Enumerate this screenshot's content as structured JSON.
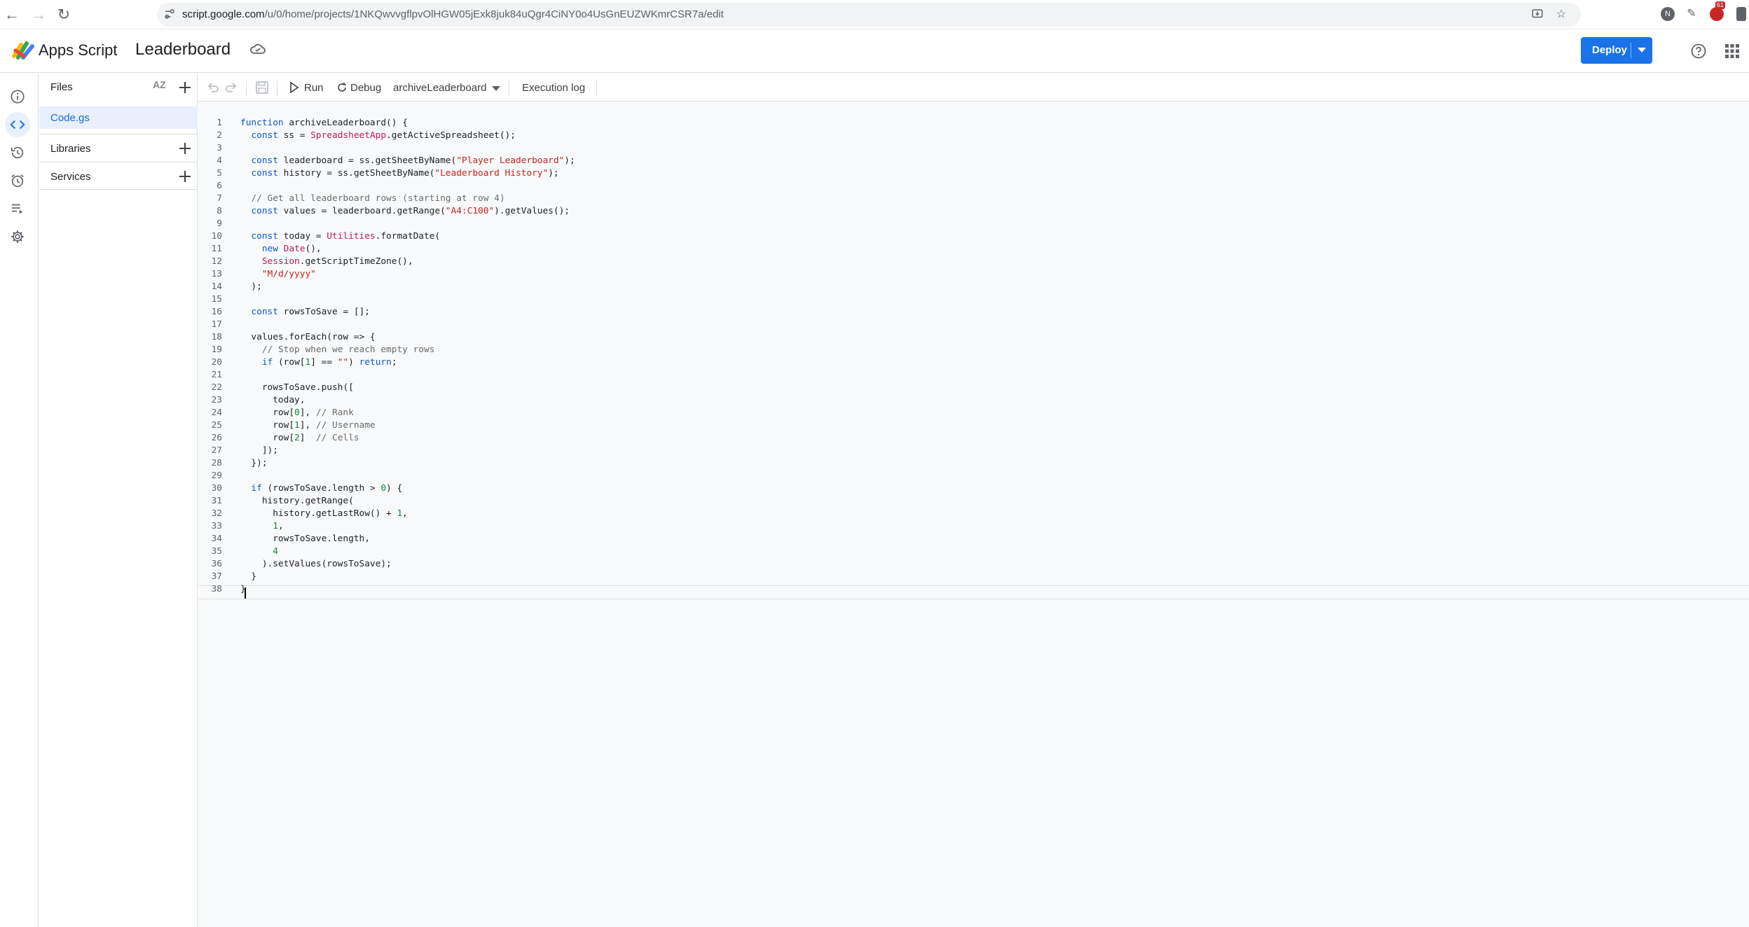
{
  "browser": {
    "url_host": "script.google.com",
    "url_path": "/u/0/home/projects/1NKQwvvgflpvOlHGW05jExk8juk84uQgr4CiNY0o4UsGnEUZWKmrCSR7a/edit",
    "extension_badge": "61",
    "profile_initial": "N"
  },
  "header": {
    "app_name": "Apps Script",
    "project_name": "Leaderboard",
    "deploy_label": "Deploy"
  },
  "files_panel": {
    "title": "Files",
    "sort_label": "AZ",
    "files": [
      "Code.gs"
    ],
    "libraries_label": "Libraries",
    "services_label": "Services"
  },
  "toolbar": {
    "run_label": "Run",
    "debug_label": "Debug",
    "function_select": "archiveLeaderboard",
    "execution_log_label": "Execution log"
  },
  "editor": {
    "line_numbers": [
      "1",
      "2",
      "3",
      "4",
      "5",
      "6",
      "7",
      "8",
      "9",
      "10",
      "11",
      "12",
      "13",
      "14",
      "15",
      "16",
      "17",
      "18",
      "19",
      "20",
      "21",
      "22",
      "23",
      "24",
      "25",
      "26",
      "27",
      "28",
      "29",
      "30",
      "31",
      "32",
      "33",
      "34",
      "35",
      "36",
      "37",
      "38"
    ],
    "lines": [
      "function archiveLeaderboard() {",
      "  const ss = SpreadsheetApp.getActiveSpreadsheet();",
      "",
      "  const leaderboard = ss.getSheetByName(\"Player Leaderboard\");",
      "  const history = ss.getSheetByName(\"Leaderboard History\");",
      "",
      "  // Get all leaderboard rows (starting at row 4)",
      "  const values = leaderboard.getRange(\"A4:C100\").getValues();",
      "",
      "  const today = Utilities.formatDate(",
      "    new Date(),",
      "    Session.getScriptTimeZone(),",
      "    \"M/d/yyyy\"",
      "  );",
      "",
      "  const rowsToSave = [];",
      "",
      "  values.forEach(row => {",
      "    // Stop when we reach empty rows",
      "    if (row[1] == \"\") return;",
      "",
      "    rowsToSave.push([",
      "      today,",
      "      row[0], // Rank",
      "      row[1], // Username",
      "      row[2]  // Cells",
      "    ]);",
      "  });",
      "",
      "  if (rowsToSave.length > 0) {",
      "    history.getRange(",
      "      history.getLastRow() + 1,",
      "      1,",
      "      rowsToSave.length,",
      "      4",
      "    ).setValues(rowsToSave);",
      "  }",
      "}"
    ]
  },
  "colors": {
    "accent": "#1a73e8",
    "keyword": "#0b57d0",
    "string": "#c5221f",
    "comment": "#6b6b6b",
    "class": "#c2185b",
    "number": "#188038"
  }
}
